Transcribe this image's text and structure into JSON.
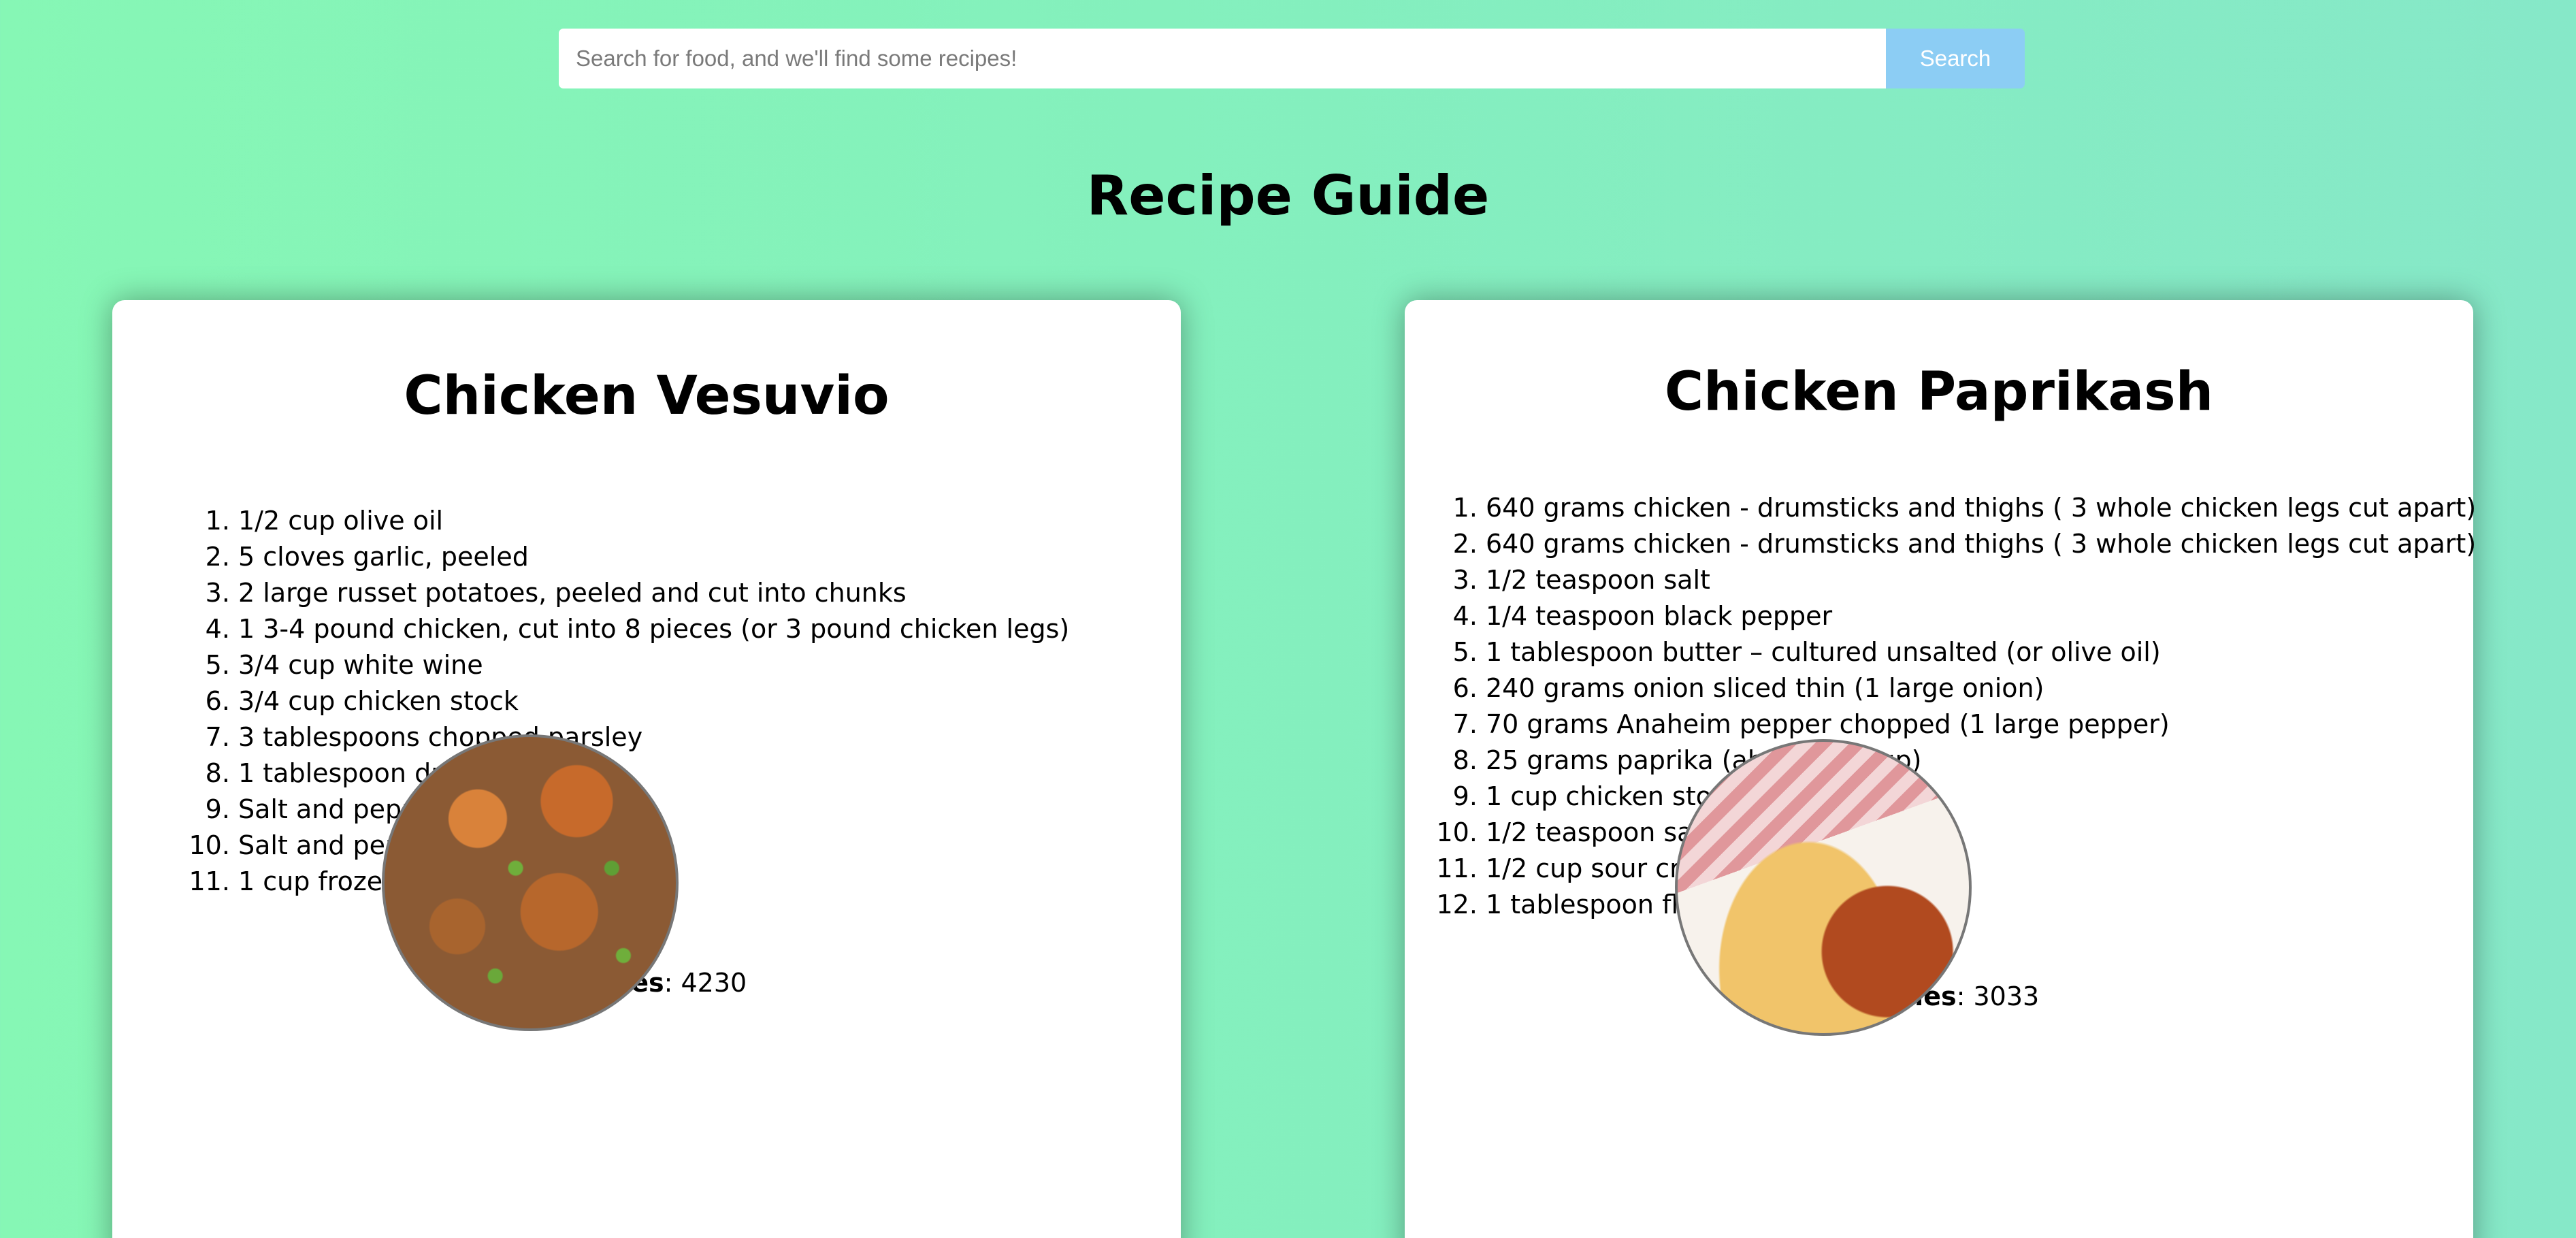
{
  "search": {
    "placeholder": "Search for food, and we'll find some recipes!",
    "button_label": "Search"
  },
  "page": {
    "title": "Recipe Guide"
  },
  "recipes": [
    {
      "title": "Chicken Vesuvio",
      "ingredients": [
        "1/2 cup olive oil",
        "5 cloves garlic, peeled",
        "2 large russet potatoes, peeled and cut into chunks",
        "1 3-4 pound chicken, cut into 8 pieces (or 3 pound chicken legs)",
        "3/4 cup white wine",
        "3/4 cup chicken stock",
        "3 tablespoons chopped parsley",
        "1 tablespoon dried oregano",
        "Salt and pepper",
        "Salt and pepper",
        "1 cup frozen peas, thawed"
      ],
      "calories_label": "Calories",
      "calories_value": ": 4230"
    },
    {
      "title": "Chicken Paprikash",
      "ingredients": [
        "640 grams chicken - drumsticks and thighs ( 3 whole chicken legs cut apart)",
        "640 grams chicken - drumsticks and thighs ( 3 whole chicken legs cut apart)",
        "1/2 teaspoon salt",
        "1/4 teaspoon black pepper",
        "1 tablespoon butter – cultured unsalted (or olive oil)",
        "240 grams onion sliced thin (1 large onion)",
        "70 grams Anaheim pepper chopped (1 large pepper)",
        "25 grams paprika (about 1/4 cup)",
        "1 cup chicken stock",
        "1/2 teaspoon salt",
        "1/2 cup sour cream",
        "1 tablespoon flour – all-purpose"
      ],
      "calories_label": "Calories",
      "calories_value": ": 3033"
    }
  ]
}
